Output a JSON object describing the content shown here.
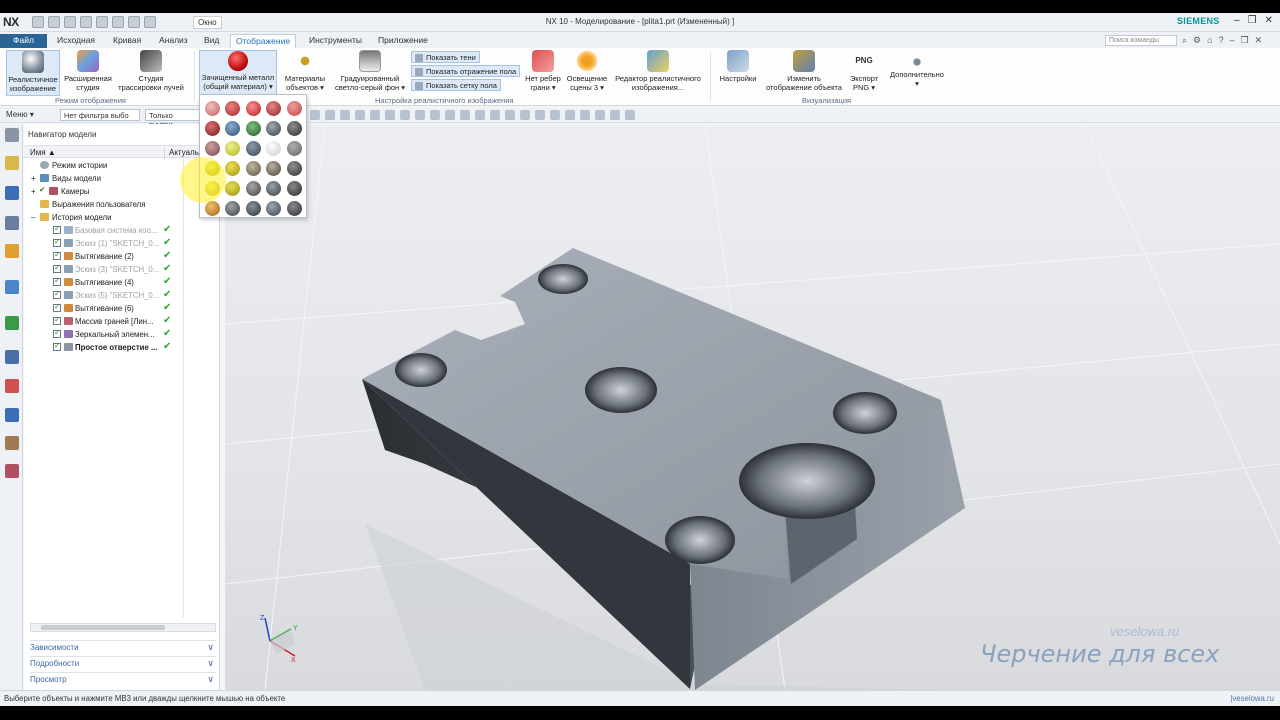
{
  "app": {
    "logo": "NX",
    "window_menu": "Окно",
    "title": "NX 10 - Моделирование - [plita1.prt (Измененный) ]",
    "brand": "SIEMENS"
  },
  "menu_tabs": [
    "Файл",
    "Исходная",
    "Кривая",
    "Анализ",
    "Вид",
    "Отображение",
    "Инструменты",
    "Приложение"
  ],
  "active_tab": "Отображение",
  "command_search_placeholder": "Поиск команды",
  "ribbon": {
    "buttons": [
      {
        "label1": "Реалистичное",
        "label2": "изображение"
      },
      {
        "label1": "Расширенная",
        "label2": "студия"
      },
      {
        "label1": "Студия",
        "label2": "трассировки лучей"
      },
      {
        "label1": "Зачищенный металл",
        "label2": "(общий материал) ▾"
      },
      {
        "label1": "Материалы",
        "label2": "объектов ▾"
      },
      {
        "label1": "Градуированный",
        "label2": "светло-серый фон ▾"
      },
      {
        "label1": "Нет ребер",
        "label2": "грани ▾"
      },
      {
        "label1": "Освещение",
        "label2": "сцены 3 ▾"
      },
      {
        "label1": "Редактор реалистичного",
        "label2": "изображения..."
      },
      {
        "label1": "Настройки",
        "label2": ""
      },
      {
        "label1": "Изменить",
        "label2": "отображение объекта"
      },
      {
        "label1": "Экспорт",
        "label2": "PNG ▾"
      },
      {
        "label1": "Дополнительно",
        "label2": "▾"
      }
    ],
    "toggles": [
      "Показать тени",
      "Показать отражение пола",
      "Показать сетку пола"
    ],
    "groups": [
      "Режим отображения",
      "Настройка реалистичного изображения",
      "Визуализация"
    ],
    "png_tag": "PNG"
  },
  "selection_bar": {
    "menu": "Меню ▾",
    "filter": "Нет фильтра выбо",
    "scope": "Только внутри"
  },
  "navigator": {
    "title": "Навигатор модели",
    "col_name": "Имя",
    "col_status": "Актуаль",
    "rows": [
      {
        "text": "Режим истории"
      },
      {
        "text": "Виды модели"
      },
      {
        "text": "Камеры"
      },
      {
        "text": "Выражения пользователя"
      },
      {
        "text": "История модели"
      },
      {
        "text": "Базовая система коо..."
      },
      {
        "text": "Эскиз (1) \"SKETCH_0..."
      },
      {
        "text": "Вытягивание (2)"
      },
      {
        "text": "Эскиз (3) \"SKETCH_0..."
      },
      {
        "text": "Вытягивание (4)"
      },
      {
        "text": "Эскиз (5) \"SKETCH_0..."
      },
      {
        "text": "Вытягивание (6)"
      },
      {
        "text": "Массив граней [Лин..."
      },
      {
        "text": "Зеркальный элемен..."
      },
      {
        "text": "Простое отверстие ..."
      }
    ],
    "sections": [
      "Зависимости",
      "Подробности",
      "Просмотр"
    ]
  },
  "status": {
    "message": "Выберите объекты и нажмите MB3 или дважды щелкните мышью на объекте",
    "brand": "|veselowa.ru"
  },
  "watermark": {
    "url": "veselowa.ru",
    "caption": "Черчение для всех"
  },
  "axis": {
    "x": "X",
    "y": "Y",
    "z": "Z"
  },
  "colors": {
    "accent": "#1e6fb8",
    "file_tab": "#2a6496",
    "status_ok": "#2aa82a",
    "siemens": "#019a9a"
  }
}
